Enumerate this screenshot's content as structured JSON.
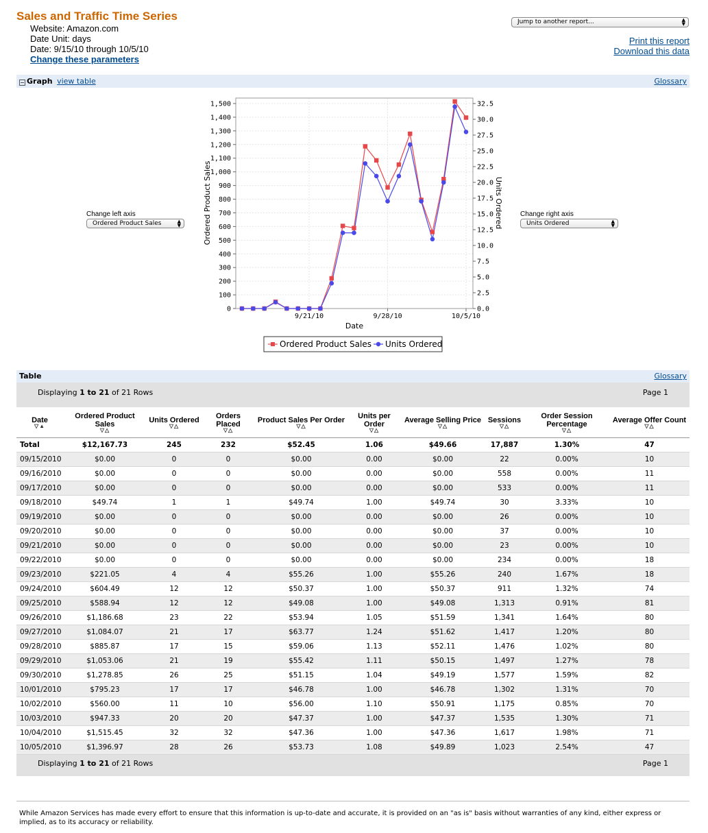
{
  "header": {
    "title": "Sales and Traffic Time Series",
    "website": "Website: Amazon.com",
    "date_unit": "Date Unit: days",
    "date_range": "Date: 9/15/10 through 10/5/10",
    "change_link": "Change these parameters"
  },
  "top_right": {
    "jump_placeholder": "Jump to another report...",
    "print_link": "Print this report",
    "download_link": "Download this data"
  },
  "graph_section": {
    "heading": "Graph",
    "view_table_link": "view table",
    "glossary_link": "Glossary",
    "left_axis_label": "Change left axis",
    "left_axis_value": "Ordered Product Sales",
    "right_axis_label": "Change right axis",
    "right_axis_value": "Units Ordered"
  },
  "chart_data": {
    "type": "line",
    "x": [
      "9/15/10",
      "9/16/10",
      "9/17/10",
      "9/18/10",
      "9/19/10",
      "9/20/10",
      "9/21/10",
      "9/22/10",
      "9/23/10",
      "9/24/10",
      "9/25/10",
      "9/26/10",
      "9/27/10",
      "9/28/10",
      "9/29/10",
      "9/30/10",
      "10/1/10",
      "10/2/10",
      "10/3/10",
      "10/4/10",
      "10/5/10"
    ],
    "x_tick_labels": [
      "9/21/10",
      "9/28/10",
      "10/5/10"
    ],
    "xlabel": "Date",
    "ylabel": "Ordered Product Sales",
    "y2label": "Units Ordered",
    "ylim": [
      0,
      1500
    ],
    "y2lim": [
      0,
      32.5
    ],
    "y_ticks": [
      "0",
      "100",
      "200",
      "300",
      "400",
      "500",
      "600",
      "700",
      "800",
      "900",
      "1,000",
      "1,100",
      "1,200",
      "1,300",
      "1,400",
      "1,500"
    ],
    "y2_ticks": [
      "0.0",
      "2.5",
      "5.0",
      "7.5",
      "10.0",
      "12.5",
      "15.0",
      "17.5",
      "20.0",
      "22.5",
      "25.0",
      "27.5",
      "30.0",
      "32.5"
    ],
    "legend_placement": "bottom",
    "series": [
      {
        "name": "Ordered Product Sales",
        "axis": "left",
        "color": "#e8474a",
        "marker": "square",
        "values": [
          0,
          0,
          0,
          49.74,
          0,
          0,
          0,
          0,
          221.05,
          604.49,
          588.94,
          1186.68,
          1084.07,
          885.87,
          1053.06,
          1278.85,
          795.23,
          560.0,
          947.33,
          1515.45,
          1396.97
        ]
      },
      {
        "name": "Units Ordered",
        "axis": "right",
        "color": "#4a4ae8",
        "marker": "circle",
        "values": [
          0,
          0,
          0,
          1,
          0,
          0,
          0,
          0,
          4,
          12,
          12,
          23,
          21,
          17,
          21,
          26,
          17,
          11,
          20,
          32,
          28
        ]
      }
    ]
  },
  "table_section": {
    "heading": "Table",
    "glossary_link": "Glossary",
    "displaying_prefix": "Displaying ",
    "displaying_range": "1 to 21",
    "displaying_suffix": " of 21 Rows",
    "page_label": "Page 1",
    "columns": [
      "Date",
      "Ordered Product Sales",
      "Units Ordered",
      "Orders Placed",
      "Product Sales Per Order",
      "Units per Order",
      "Average Selling Price",
      "Sessions",
      "Order Session Percentage",
      "Average Offer Count"
    ],
    "total": [
      "Total",
      "$12,167.73",
      "245",
      "232",
      "$52.45",
      "1.06",
      "$49.66",
      "17,887",
      "1.30%",
      "47"
    ],
    "rows": [
      [
        "09/15/2010",
        "$0.00",
        "0",
        "0",
        "$0.00",
        "0.00",
        "$0.00",
        "22",
        "0.00%",
        "10"
      ],
      [
        "09/16/2010",
        "$0.00",
        "0",
        "0",
        "$0.00",
        "0.00",
        "$0.00",
        "558",
        "0.00%",
        "11"
      ],
      [
        "09/17/2010",
        "$0.00",
        "0",
        "0",
        "$0.00",
        "0.00",
        "$0.00",
        "533",
        "0.00%",
        "11"
      ],
      [
        "09/18/2010",
        "$49.74",
        "1",
        "1",
        "$49.74",
        "1.00",
        "$49.74",
        "30",
        "3.33%",
        "10"
      ],
      [
        "09/19/2010",
        "$0.00",
        "0",
        "0",
        "$0.00",
        "0.00",
        "$0.00",
        "26",
        "0.00%",
        "10"
      ],
      [
        "09/20/2010",
        "$0.00",
        "0",
        "0",
        "$0.00",
        "0.00",
        "$0.00",
        "37",
        "0.00%",
        "10"
      ],
      [
        "09/21/2010",
        "$0.00",
        "0",
        "0",
        "$0.00",
        "0.00",
        "$0.00",
        "23",
        "0.00%",
        "10"
      ],
      [
        "09/22/2010",
        "$0.00",
        "0",
        "0",
        "$0.00",
        "0.00",
        "$0.00",
        "234",
        "0.00%",
        "18"
      ],
      [
        "09/23/2010",
        "$221.05",
        "4",
        "4",
        "$55.26",
        "1.00",
        "$55.26",
        "240",
        "1.67%",
        "18"
      ],
      [
        "09/24/2010",
        "$604.49",
        "12",
        "12",
        "$50.37",
        "1.00",
        "$50.37",
        "911",
        "1.32%",
        "74"
      ],
      [
        "09/25/2010",
        "$588.94",
        "12",
        "12",
        "$49.08",
        "1.00",
        "$49.08",
        "1,313",
        "0.91%",
        "81"
      ],
      [
        "09/26/2010",
        "$1,186.68",
        "23",
        "22",
        "$53.94",
        "1.05",
        "$51.59",
        "1,341",
        "1.64%",
        "80"
      ],
      [
        "09/27/2010",
        "$1,084.07",
        "21",
        "17",
        "$63.77",
        "1.24",
        "$51.62",
        "1,417",
        "1.20%",
        "80"
      ],
      [
        "09/28/2010",
        "$885.87",
        "17",
        "15",
        "$59.06",
        "1.13",
        "$52.11",
        "1,476",
        "1.02%",
        "80"
      ],
      [
        "09/29/2010",
        "$1,053.06",
        "21",
        "19",
        "$55.42",
        "1.11",
        "$50.15",
        "1,497",
        "1.27%",
        "78"
      ],
      [
        "09/30/2010",
        "$1,278.85",
        "26",
        "25",
        "$51.15",
        "1.04",
        "$49.19",
        "1,577",
        "1.59%",
        "82"
      ],
      [
        "10/01/2010",
        "$795.23",
        "17",
        "17",
        "$46.78",
        "1.00",
        "$46.78",
        "1,302",
        "1.31%",
        "70"
      ],
      [
        "10/02/2010",
        "$560.00",
        "11",
        "10",
        "$56.00",
        "1.10",
        "$50.91",
        "1,175",
        "0.85%",
        "70"
      ],
      [
        "10/03/2010",
        "$947.33",
        "20",
        "20",
        "$47.37",
        "1.00",
        "$47.37",
        "1,535",
        "1.30%",
        "71"
      ],
      [
        "10/04/2010",
        "$1,515.45",
        "32",
        "32",
        "$47.36",
        "1.00",
        "$47.36",
        "1,617",
        "1.98%",
        "71"
      ],
      [
        "10/05/2010",
        "$1,396.97",
        "28",
        "26",
        "$53.73",
        "1.08",
        "$49.89",
        "1,023",
        "2.54%",
        "47"
      ]
    ]
  },
  "footer": {
    "disclaimer": "While Amazon Services has made every effort to ensure that this information is up-to-date and accurate, it is provided on an \"as is\" basis without warranties of any kind, either express or implied, as to its accuracy or reliability."
  }
}
